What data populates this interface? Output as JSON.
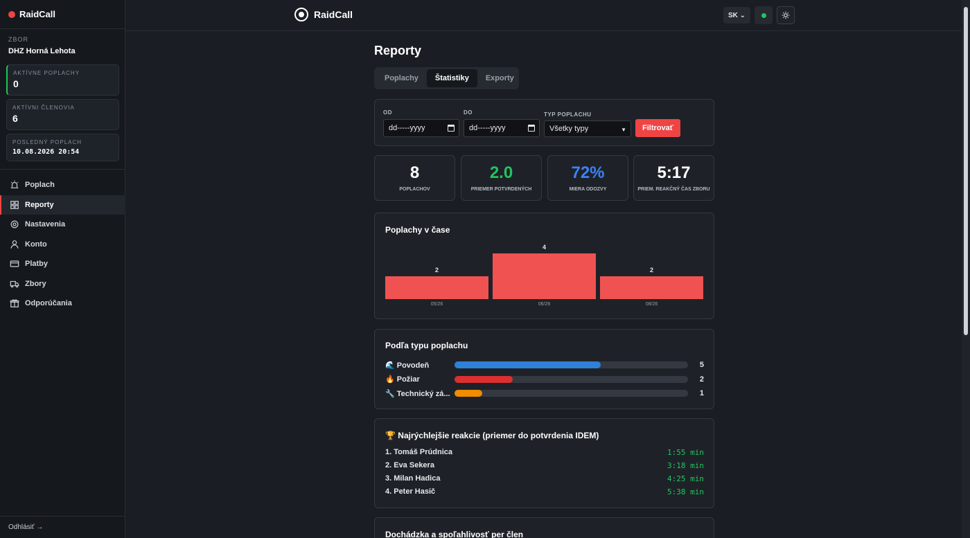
{
  "sidebar": {
    "brand": "RaidCall",
    "zbor_label": "ZBOR",
    "zbor_name": "DHZ Horná Lehota",
    "stats": [
      {
        "label": "AKTÍVNE POPLACHY",
        "value": "0"
      },
      {
        "label": "AKTÍVNI ČLENOVIA",
        "value": "6"
      },
      {
        "label": "POSLEDNÝ POPLACH",
        "value": "10.08.2026 20:54"
      }
    ],
    "nav": [
      {
        "label": "Poplach",
        "icon": "siren-icon"
      },
      {
        "label": "Reporty",
        "icon": "grid-icon"
      },
      {
        "label": "Nastavenia",
        "icon": "gear-icon"
      },
      {
        "label": "Konto",
        "icon": "user-icon"
      },
      {
        "label": "Platby",
        "icon": "card-icon"
      },
      {
        "label": "Zbory",
        "icon": "truck-icon"
      },
      {
        "label": "Odporúčania",
        "icon": "gift-icon"
      }
    ],
    "logout": "Odhlásiť →"
  },
  "header": {
    "logo": "RaidCall",
    "lang": "SK ⌄",
    "status_color": "#22c55e"
  },
  "main": {
    "title": "Reporty",
    "tabs": [
      "Poplachy",
      "Štatistiky",
      "Exporty"
    ],
    "active_tab": "Štatistiky",
    "filter": {
      "from_label": "OD",
      "from_value": "dd-----yyyy",
      "to_label": "DO",
      "to_value": "dd-----yyyy",
      "type_label": "TYP POPLACHU",
      "type_value": "Všetky typy",
      "button": "Filtrovať"
    },
    "kpis": [
      {
        "value": "8",
        "label": "POPLACHOV",
        "color": "#ffffff"
      },
      {
        "value": "2.0",
        "label": "PRIEMER POTVRDENÝCH",
        "color": "#22c55e"
      },
      {
        "value": "72%",
        "label": "MIERA ODOZVY",
        "color": "#3b82f6"
      },
      {
        "value": "5:17",
        "label": "PRIEM. REAKČNÝ ČAS ZBORU",
        "color": "#ffffff"
      }
    ],
    "by_type": {
      "title": "Podľa typu poplachu",
      "items": [
        {
          "label": "🌊 Povodeň",
          "count": "5",
          "fraction": 0.625,
          "color": "#2f80d9"
        },
        {
          "label": "🔥 Požiar",
          "count": "2",
          "fraction": 0.25,
          "color": "#dc2f2f"
        },
        {
          "label": "🔧 Technický zá...",
          "count": "1",
          "fraction": 0.12,
          "color": "#f08c00"
        }
      ]
    },
    "fastest": {
      "title": "🏆 Najrýchlejšie reakcie (priemer do potvrdenia IDEM)",
      "rows": [
        {
          "name": "1. Tomáš Prúdnica",
          "time": "1:55 min"
        },
        {
          "name": "2. Eva Sekera",
          "time": "3:18 min"
        },
        {
          "name": "3. Milan Hadica",
          "time": "4:25 min"
        },
        {
          "name": "4. Peter Hasič",
          "time": "5:38 min"
        }
      ]
    },
    "attendance_title": "Dochádzka a spoľahlivosť per člen"
  },
  "chart_data": {
    "type": "bar",
    "title": "Poplachy v čase",
    "categories": [
      "05/26",
      "06/26",
      "08/26"
    ],
    "values": [
      2,
      4,
      2
    ],
    "ylim": [
      0,
      4
    ],
    "grid": false,
    "color": "#f05252"
  }
}
